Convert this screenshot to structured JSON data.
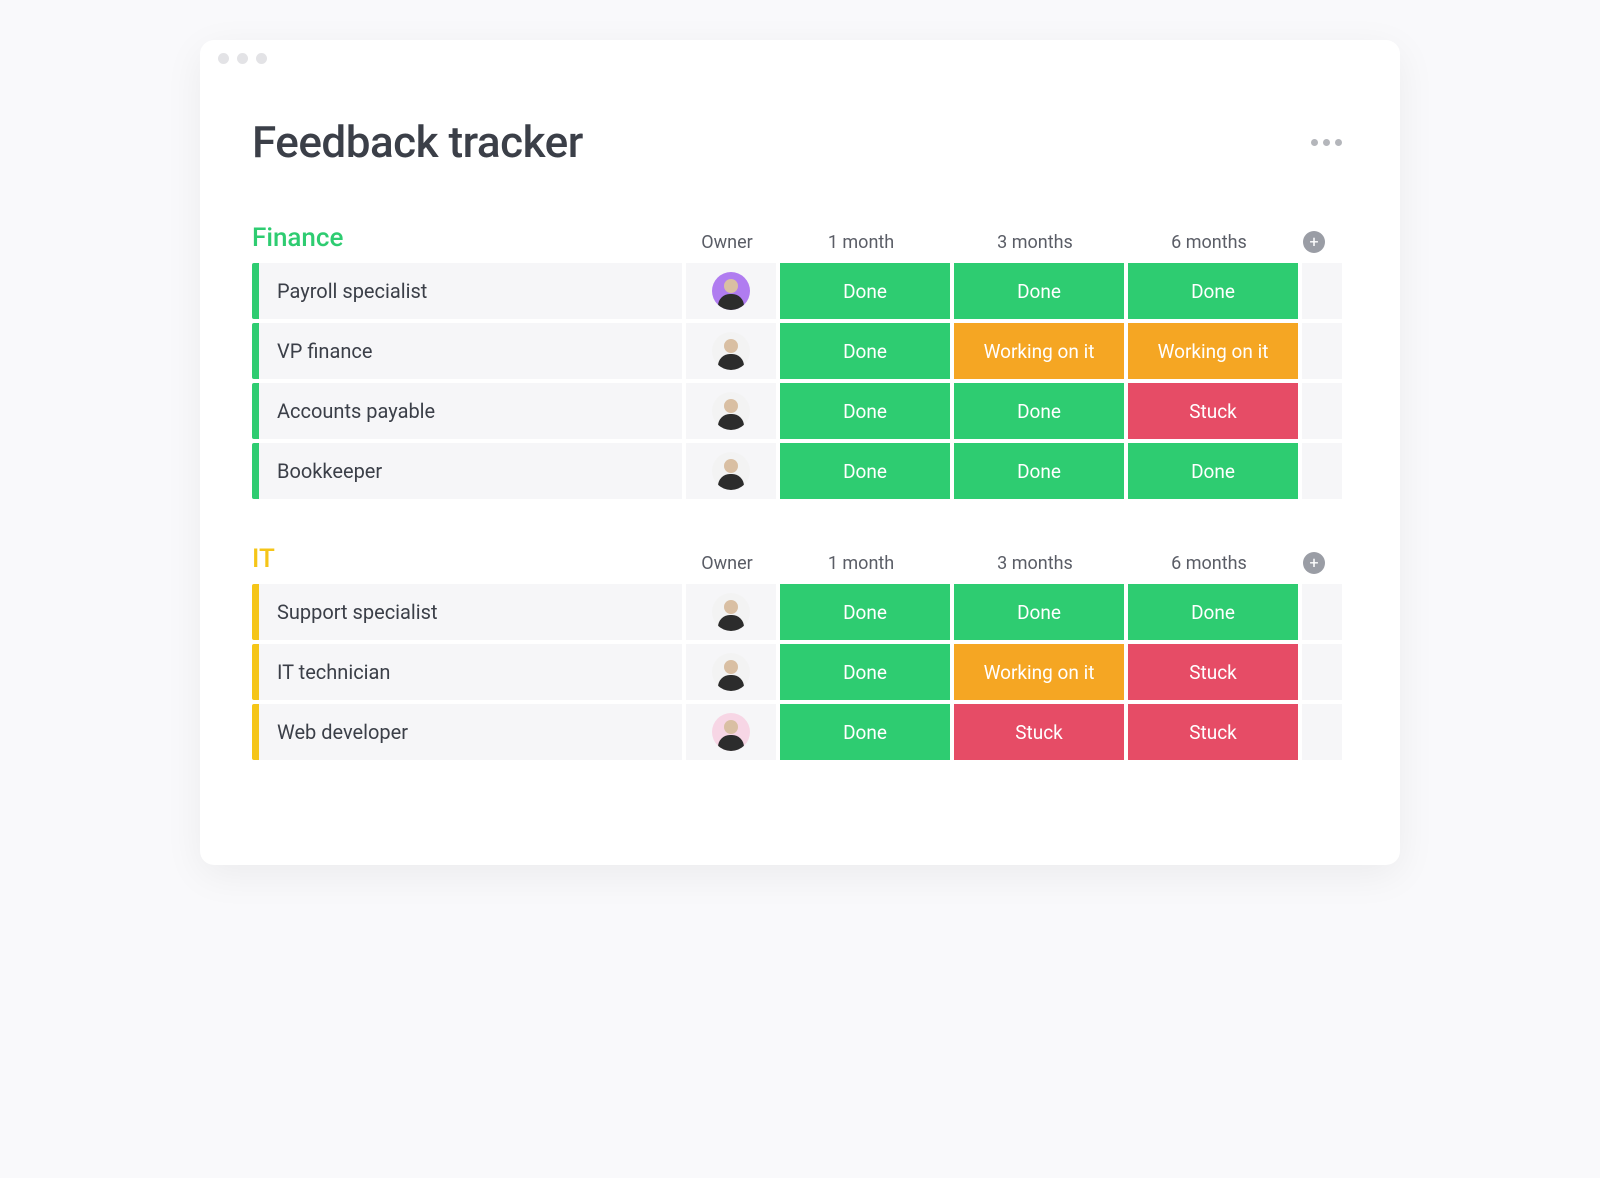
{
  "board": {
    "title": "Feedback tracker"
  },
  "columns": {
    "owner": "Owner",
    "month1": "1 month",
    "month3": "3 months",
    "month6": "6 months"
  },
  "status_colors": {
    "Done": "#2ecc71",
    "Working on it": "#f5a623",
    "Stuck": "#e64c66"
  },
  "avatar_colors": [
    "#b07cf0",
    "#f3f3f3",
    "#f3f3f3",
    "#f3f3f3",
    "#f3f3f3",
    "#f3f3f3",
    "#f7d6e5"
  ],
  "groups": [
    {
      "name": "Finance",
      "color": "#2ecc71",
      "rows": [
        {
          "name": "Payroll specialist",
          "status": [
            "Done",
            "Done",
            "Done"
          ]
        },
        {
          "name": "VP finance",
          "status": [
            "Done",
            "Working on it",
            "Working on it"
          ]
        },
        {
          "name": "Accounts payable",
          "status": [
            "Done",
            "Done",
            "Stuck"
          ]
        },
        {
          "name": "Bookkeeper",
          "status": [
            "Done",
            "Done",
            "Done"
          ]
        }
      ]
    },
    {
      "name": "IT",
      "color": "#f5c518",
      "rows": [
        {
          "name": "Support specialist",
          "status": [
            "Done",
            "Done",
            "Done"
          ]
        },
        {
          "name": "IT technician",
          "status": [
            "Done",
            "Working on it",
            "Stuck"
          ]
        },
        {
          "name": "Web developer",
          "status": [
            "Done",
            "Stuck",
            "Stuck"
          ]
        }
      ]
    }
  ]
}
